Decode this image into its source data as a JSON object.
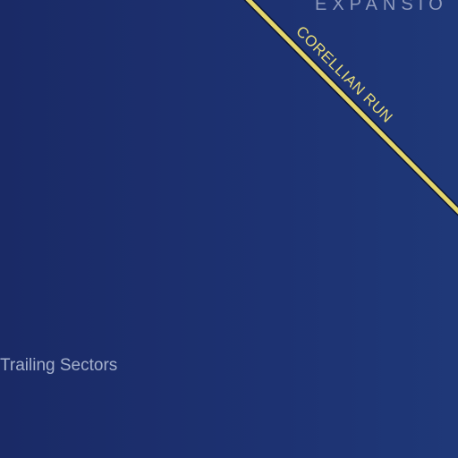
{
  "map": {
    "background_color": "#1c2f6f",
    "regions": {
      "expansion_region": "EXPANSIO",
      "trailing_sectors": "Trailing Sectors"
    },
    "routes": [
      {
        "name": "CORELLIAN RUN",
        "color": "#e3d56c",
        "outline_color": "#0c1430"
      }
    ]
  }
}
